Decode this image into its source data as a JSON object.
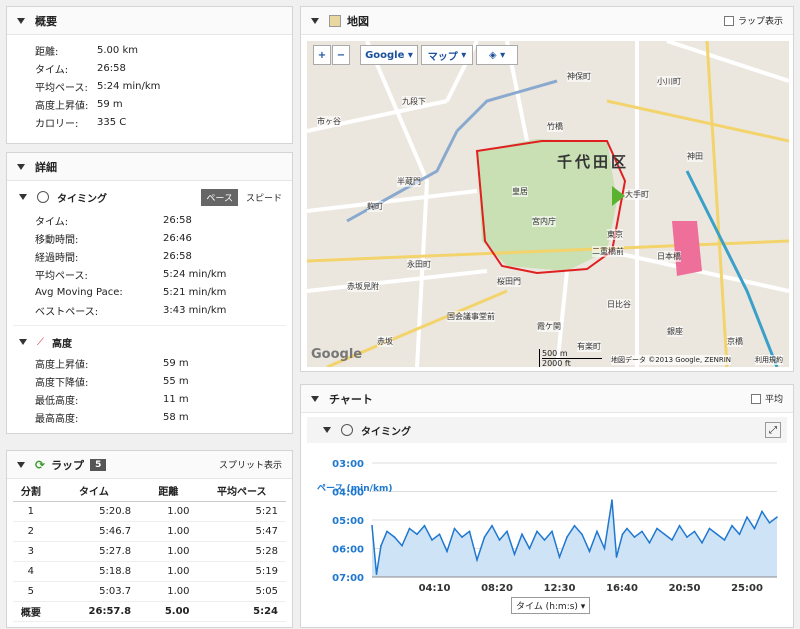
{
  "summary": {
    "title": "概要",
    "rows": [
      {
        "k": "距離:",
        "v": "5.00 km"
      },
      {
        "k": "タイム:",
        "v": "26:58"
      },
      {
        "k": "平均ペース:",
        "v": "5:24 min/km"
      },
      {
        "k": "高度上昇値:",
        "v": "59 m"
      },
      {
        "k": "カロリー:",
        "v": "335 C"
      }
    ]
  },
  "details": {
    "title": "詳細",
    "timing_title": "タイミング",
    "pace_tab": "ペース",
    "speed_tab": "スピード",
    "timing": [
      {
        "k": "タイム:",
        "v": "26:58"
      },
      {
        "k": "移動時間:",
        "v": "26:46"
      },
      {
        "k": "経過時間:",
        "v": "26:58"
      },
      {
        "k": "平均ペース:",
        "v": "5:24 min/km"
      },
      {
        "k": "Avg Moving Pace:",
        "v": "5:21 min/km"
      },
      {
        "k": "ベストペース:",
        "v": "3:43 min/km"
      }
    ],
    "elev_title": "高度",
    "elevation": [
      {
        "k": "高度上昇値:",
        "v": "59 m"
      },
      {
        "k": "高度下降値:",
        "v": "55 m"
      },
      {
        "k": "最低高度:",
        "v": "11 m"
      },
      {
        "k": "最高高度:",
        "v": "58 m"
      }
    ]
  },
  "laps": {
    "title": "ラップ",
    "count": "5",
    "split_link": "スプリット表示",
    "headers": [
      "分割",
      "タイム",
      "距離",
      "平均ペース"
    ],
    "rows": [
      [
        "1",
        "5:20.8",
        "1.00",
        "5:21"
      ],
      [
        "2",
        "5:46.7",
        "1.00",
        "5:47"
      ],
      [
        "3",
        "5:27.8",
        "1.00",
        "5:28"
      ],
      [
        "4",
        "5:18.8",
        "1.00",
        "5:19"
      ],
      [
        "5",
        "5:03.7",
        "1.00",
        "5:05"
      ]
    ],
    "total": [
      "概要",
      "26:57.8",
      "5.00",
      "5:24"
    ]
  },
  "map": {
    "title": "地図",
    "lap_toggle": "ラップ表示",
    "zoom_in": "+",
    "zoom_out": "−",
    "google_btn": "Google",
    "map_btn": "マップ",
    "district": "千代田区",
    "logo": "Google",
    "scale_m": "500 m",
    "scale_ft": "2000 ft",
    "attribution": "地図データ ©2013 Google, ZENRIN",
    "terms": "利用規約",
    "labels": [
      {
        "t": "市ヶ谷"
      },
      {
        "t": "九段下"
      },
      {
        "t": "竹橋"
      },
      {
        "t": "大手町"
      },
      {
        "t": "東京"
      },
      {
        "t": "日本橋"
      },
      {
        "t": "神田"
      },
      {
        "t": "半蔵門"
      },
      {
        "t": "麹町"
      },
      {
        "t": "永田町"
      },
      {
        "t": "赤坂見附"
      },
      {
        "t": "桜田門"
      },
      {
        "t": "霞ケ関"
      },
      {
        "t": "日比谷"
      },
      {
        "t": "有楽町"
      },
      {
        "t": "銀座"
      },
      {
        "t": "京橋"
      },
      {
        "t": "小川町"
      },
      {
        "t": "神保町"
      },
      {
        "t": "皇居"
      },
      {
        "t": "宮内庁"
      },
      {
        "t": "二重橋前"
      },
      {
        "t": "国会議事堂前"
      },
      {
        "t": "赤坂"
      }
    ]
  },
  "chart": {
    "title": "チャート",
    "avg_toggle": "平均",
    "section": "タイミング",
    "ylabel": "ペース (min/km)",
    "xaxis_select": "タイム (h:m:s)",
    "line_color": "#1f78d0",
    "fill_color": "#cfe3f7"
  },
  "chart_data": {
    "type": "area",
    "ylabel": "ペース (min/km)",
    "xlabel": "タイム (h:m:s)",
    "y_ticks": [
      "03:00",
      "04:00",
      "05:00",
      "06:00",
      "07:00"
    ],
    "y_range_min": [
      3,
      7
    ],
    "y_inverted": true,
    "x_ticks": [
      "04:10",
      "08:20",
      "12:30",
      "16:40",
      "20:50",
      "25:00"
    ],
    "x_range_min": [
      0,
      27
    ],
    "series": [
      {
        "values": [
          [
            0,
            5.2
          ],
          [
            0.3,
            6.9
          ],
          [
            0.6,
            5.9
          ],
          [
            1,
            5.4
          ],
          [
            1.5,
            5.6
          ],
          [
            2,
            5.9
          ],
          [
            2.5,
            5.3
          ],
          [
            3,
            5.5
          ],
          [
            3.5,
            5.2
          ],
          [
            4,
            5.7
          ],
          [
            4.5,
            5.5
          ],
          [
            5,
            6.1
          ],
          [
            5.5,
            5.3
          ],
          [
            6,
            5.6
          ],
          [
            6.5,
            5.4
          ],
          [
            7,
            6.4
          ],
          [
            7.5,
            5.6
          ],
          [
            8,
            5.2
          ],
          [
            8.5,
            5.7
          ],
          [
            9,
            5.4
          ],
          [
            9.5,
            6.2
          ],
          [
            10,
            5.5
          ],
          [
            10.5,
            6.0
          ],
          [
            11,
            5.4
          ],
          [
            11.5,
            5.7
          ],
          [
            12,
            5.4
          ],
          [
            12.5,
            6.3
          ],
          [
            13,
            5.6
          ],
          [
            13.5,
            5.2
          ],
          [
            14,
            5.5
          ],
          [
            14.5,
            6.1
          ],
          [
            15,
            5.4
          ],
          [
            15.5,
            6.0
          ],
          [
            16,
            4.3
          ],
          [
            16.3,
            6.3
          ],
          [
            16.7,
            5.5
          ],
          [
            17,
            5.3
          ],
          [
            17.5,
            5.6
          ],
          [
            18,
            5.4
          ],
          [
            18.5,
            5.8
          ],
          [
            19,
            5.3
          ],
          [
            19.5,
            5.5
          ],
          [
            20,
            5.7
          ],
          [
            20.5,
            5.2
          ],
          [
            21,
            5.6
          ],
          [
            21.5,
            5.4
          ],
          [
            22,
            5.8
          ],
          [
            22.5,
            5.3
          ],
          [
            23,
            5.5
          ],
          [
            23.5,
            5.7
          ],
          [
            24,
            5.2
          ],
          [
            24.5,
            5.5
          ],
          [
            25,
            4.9
          ],
          [
            25.5,
            5.3
          ],
          [
            26,
            4.7
          ],
          [
            26.5,
            5.1
          ],
          [
            27,
            4.9
          ]
        ]
      }
    ]
  }
}
